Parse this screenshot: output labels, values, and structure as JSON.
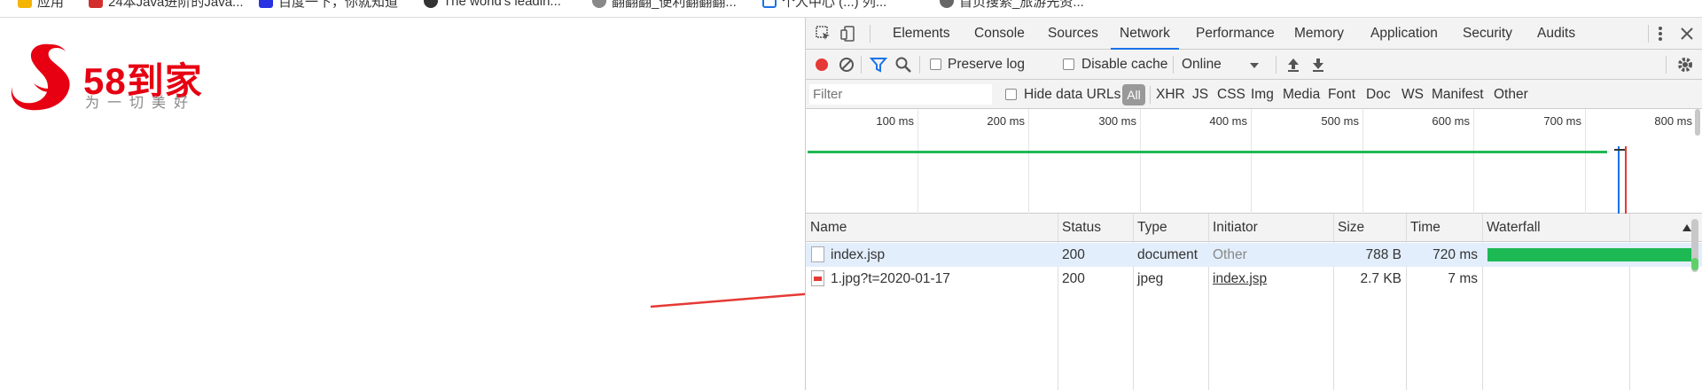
{
  "bookmarks": [
    {
      "label": "应用",
      "icon": "apps-grid-icon",
      "color": "#f4b400"
    },
    {
      "label": "24本Java进阶的Java...",
      "icon": "red-bookmark-icon",
      "color": "#d32f2f"
    },
    {
      "label": "百度一下，你就知道",
      "icon": "baidu-icon",
      "color": "#2932e1"
    },
    {
      "label": "The world's leadin...",
      "icon": "github-icon",
      "color": "#333333"
    },
    {
      "label": "翻翻翻_便利翻翻翻...",
      "icon": "globe-icon",
      "color": "#888888"
    },
    {
      "label": "个人中心 (...) 列...",
      "icon": "bookmark-icon",
      "color": "#1a73e8"
    },
    {
      "label": "首页搜索_旅游先资...",
      "icon": "person-icon",
      "color": "#666666"
    }
  ],
  "logo": {
    "text": "58到家",
    "subtitle": "为一切美好",
    "color": "#e60012"
  },
  "devtools": {
    "tabs": [
      "Elements",
      "Console",
      "Sources",
      "Network",
      "Performance",
      "Memory",
      "Application",
      "Security",
      "Audits"
    ],
    "active_tab": "Network",
    "accent": "#1a73e8",
    "toolbar": {
      "preserve_log": "Preserve log",
      "disable_cache": "Disable cache",
      "throttle": "Online"
    },
    "filter": {
      "placeholder": "Filter",
      "hide_data_urls": "Hide data URLs",
      "types": [
        "All",
        "XHR",
        "JS",
        "CSS",
        "Img",
        "Media",
        "Font",
        "Doc",
        "WS",
        "Manifest",
        "Other"
      ]
    },
    "overview": {
      "ticks": [
        "100 ms",
        "200 ms",
        "300 ms",
        "400 ms",
        "500 ms",
        "600 ms",
        "700 ms",
        "800 ms"
      ]
    },
    "table": {
      "columns": [
        "Name",
        "Status",
        "Type",
        "Initiator",
        "Size",
        "Time",
        "Waterfall"
      ],
      "rows": [
        {
          "name": "index.jsp",
          "status": "200",
          "type": "document",
          "initiator": "Other",
          "size": "788 B",
          "time": "720 ms"
        },
        {
          "name": "1.jpg?t=2020-01-17",
          "status": "200",
          "type": "jpeg",
          "initiator": "index.jsp",
          "size": "2.7 KB",
          "time": "7 ms"
        }
      ]
    }
  }
}
